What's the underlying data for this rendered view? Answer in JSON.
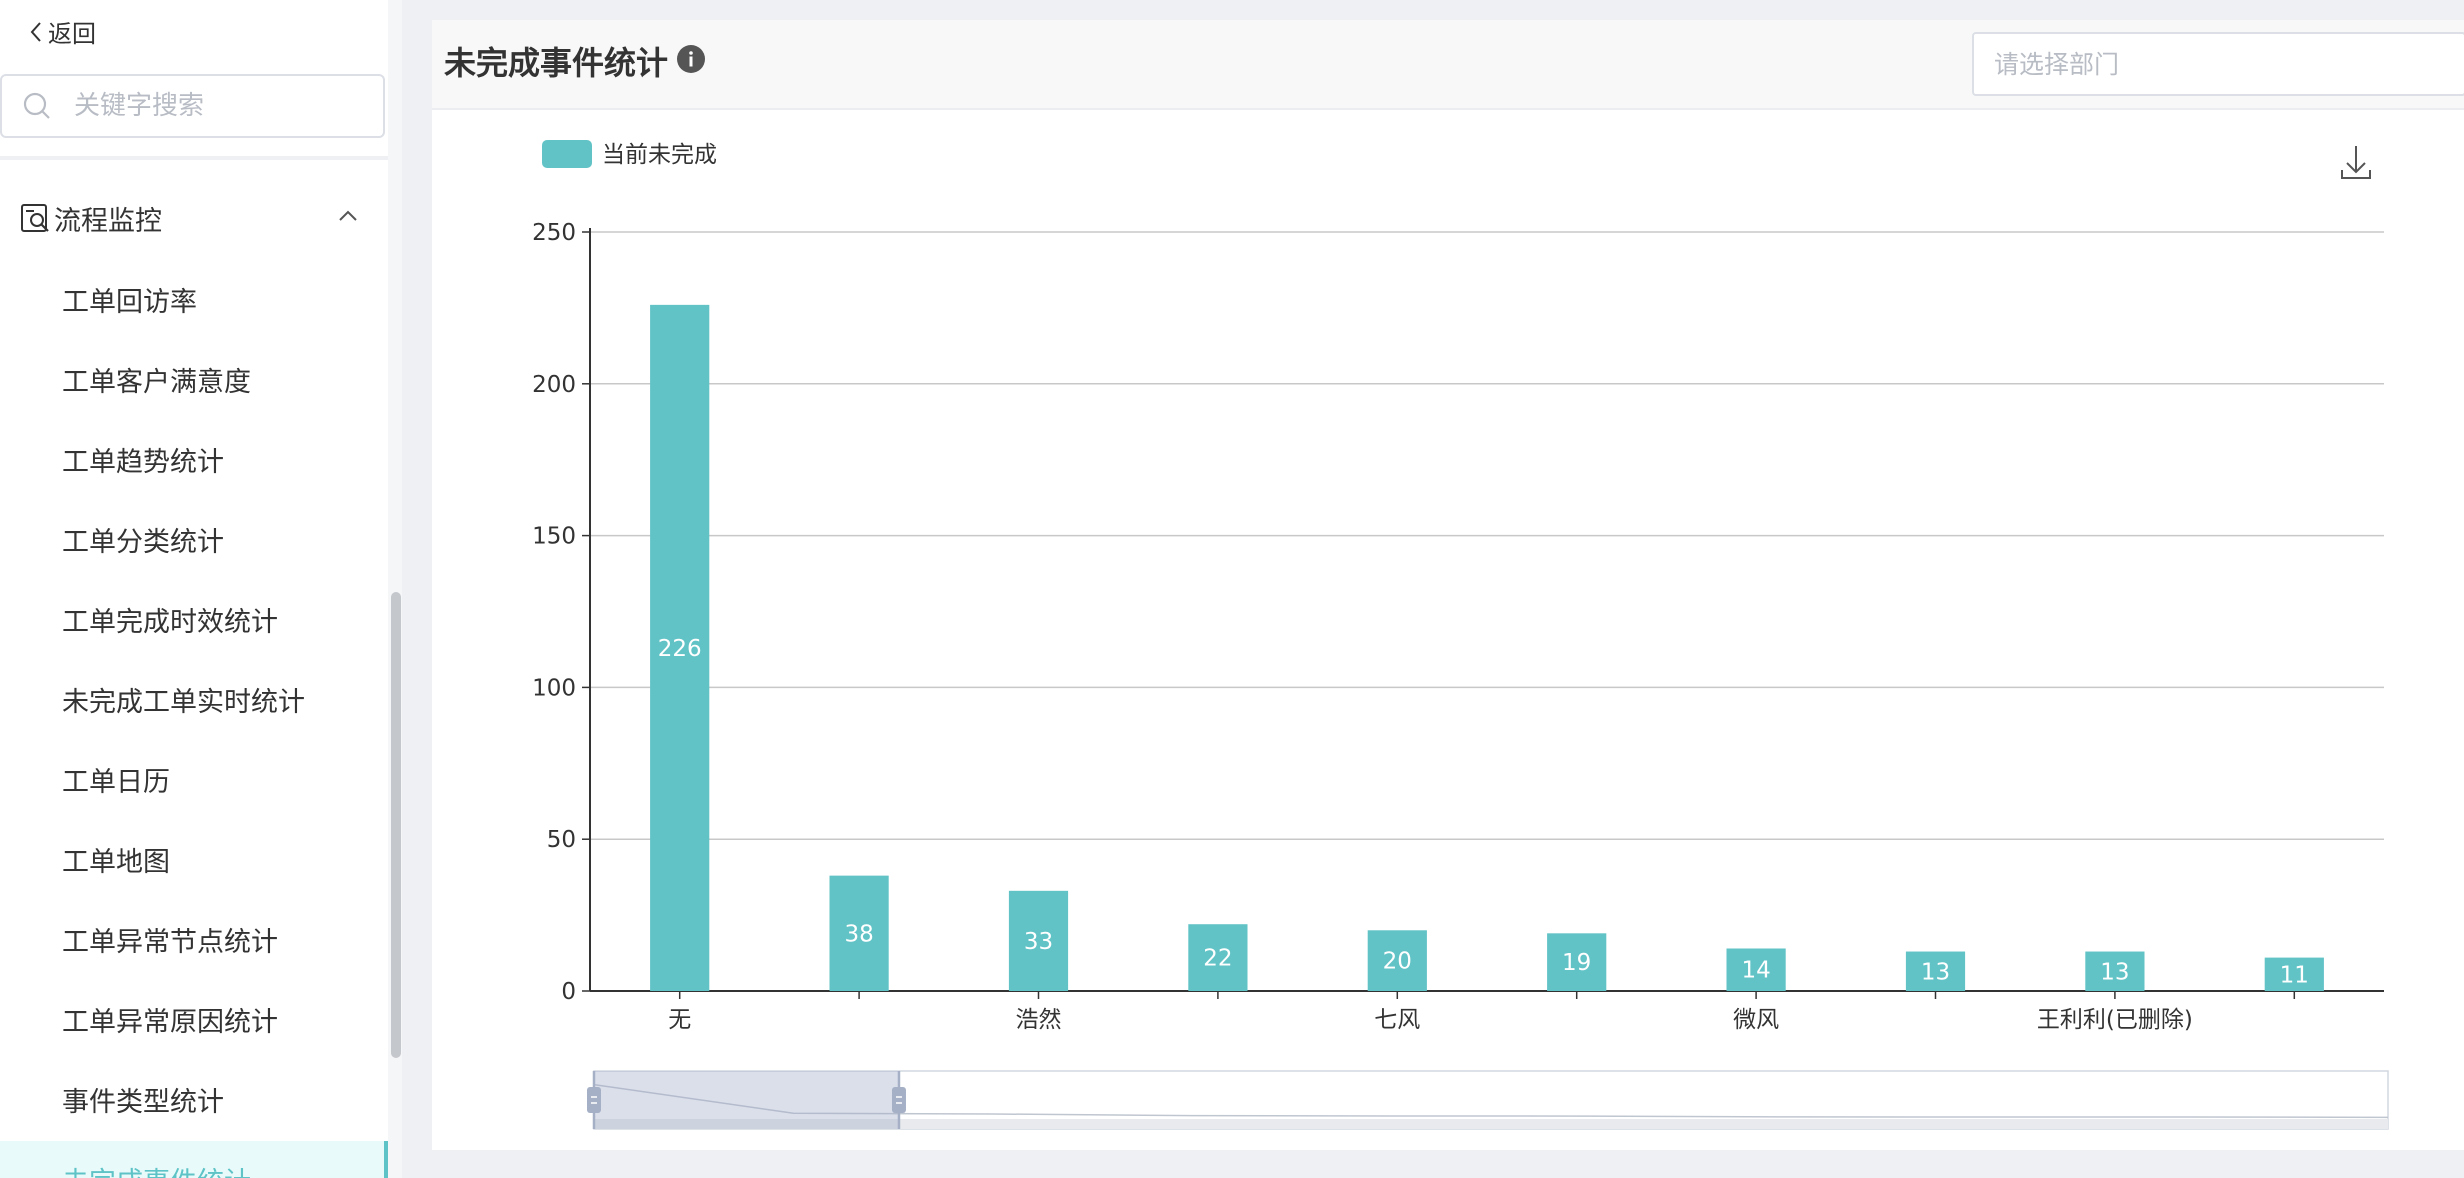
{
  "sidebar": {
    "back_label": "返回",
    "search_placeholder": "关键字搜索",
    "group_label": "流程监控",
    "items": [
      {
        "label": "工单回访率"
      },
      {
        "label": "工单客户满意度"
      },
      {
        "label": "工单趋势统计"
      },
      {
        "label": "工单分类统计"
      },
      {
        "label": "工单完成时效统计"
      },
      {
        "label": "未完成工单实时统计"
      },
      {
        "label": "工单日历"
      },
      {
        "label": "工单地图"
      },
      {
        "label": "工单异常节点统计"
      },
      {
        "label": "工单异常原因统计"
      },
      {
        "label": "事件类型统计"
      },
      {
        "label": "未完成事件统计"
      }
    ]
  },
  "header": {
    "title": "未完成事件统计",
    "dept_placeholder": "请选择部门"
  },
  "colors": {
    "accent": "#5ec3c6",
    "bar": "#62c3c6"
  },
  "chart_data": {
    "type": "bar",
    "title": "未完成事件统计",
    "legend": [
      "当前未完成"
    ],
    "legend_position": "top-left",
    "categories": [
      "无",
      "",
      "浩然",
      "",
      "七风",
      "",
      "微风",
      "",
      "王利利(已删除)",
      ""
    ],
    "series": [
      {
        "name": "当前未完成",
        "values": [
          226,
          38,
          33,
          22,
          20,
          19,
          14,
          13,
          13,
          11
        ]
      }
    ],
    "ylim": [
      0,
      250
    ],
    "yticks": [
      0,
      50,
      100,
      150,
      200,
      250
    ],
    "grid": true,
    "data_labels": true,
    "download_icon": "download-icon",
    "datazoom": {
      "start_fraction": 0.0,
      "end_fraction": 0.17
    }
  }
}
